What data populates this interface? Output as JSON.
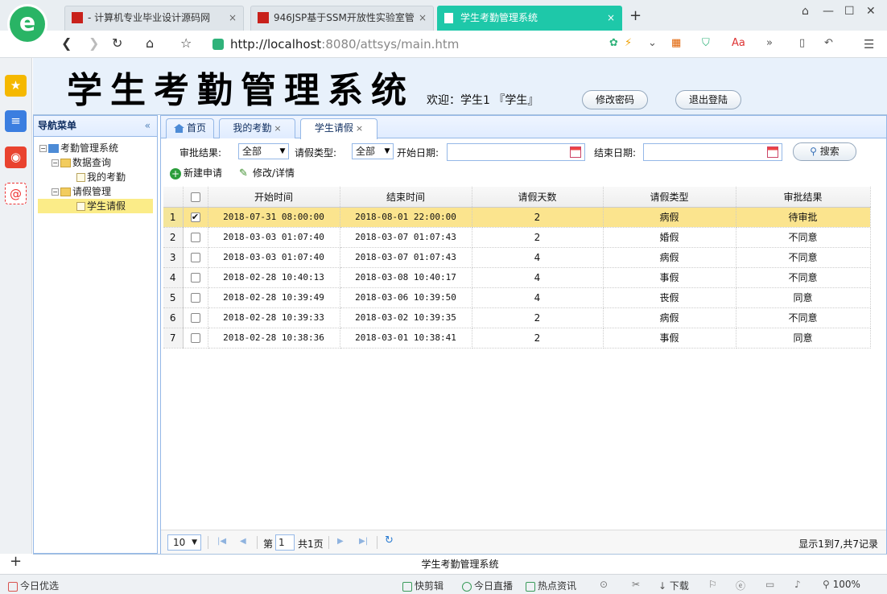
{
  "browser": {
    "tabs": [
      {
        "label": "- 计算机专业毕业设计源码网",
        "close": "×"
      },
      {
        "label": "946JSP基于SSM开放性实验室管",
        "close": "×"
      },
      {
        "label": "学生考勤管理系统",
        "close": "×"
      }
    ],
    "new_tab": "+",
    "url_host": "http://localhost",
    "url_rest": ":8080/attsys/main.htm"
  },
  "header": {
    "system_title": "学生考勤管理系统",
    "welcome": "欢迎：学生1 『学生』",
    "change_password_label": "修改密码",
    "logout_label": "退出登陆"
  },
  "nav": {
    "title": "导航菜单",
    "collapse": "«",
    "tree": {
      "root": "考勤管理系统",
      "group1": "数据查询",
      "group1_item1": "我的考勤",
      "group2": "请假管理",
      "group2_item1": "学生请假"
    }
  },
  "tabs": {
    "home": "首页",
    "attendance": "我的考勤",
    "leave": "学生请假",
    "close": "×"
  },
  "filters": {
    "approval_label": "审批结果:",
    "approval_value": "全部",
    "type_label": "请假类型:",
    "type_value": "全部",
    "start_label": "开始日期:",
    "end_label": "结束日期:",
    "search_label": "搜索"
  },
  "actions": {
    "new_label": "新建申请",
    "edit_label": "修改/详情"
  },
  "grid": {
    "columns": {
      "start": "开始时间",
      "end": "结束时间",
      "days": "请假天数",
      "type": "请假类型",
      "result": "审批结果"
    },
    "rows": [
      {
        "n": "1",
        "start": "2018-07-31 08:00:00",
        "end": "2018-08-01 22:00:00",
        "days": "2",
        "type": "病假",
        "result": "待审批"
      },
      {
        "n": "2",
        "start": "2018-03-03 01:07:40",
        "end": "2018-03-07 01:07:43",
        "days": "2",
        "type": "婚假",
        "result": "不同意"
      },
      {
        "n": "3",
        "start": "2018-03-03 01:07:40",
        "end": "2018-03-07 01:07:43",
        "days": "4",
        "type": "病假",
        "result": "不同意"
      },
      {
        "n": "4",
        "start": "2018-02-28 10:40:13",
        "end": "2018-03-08 10:40:17",
        "days": "4",
        "type": "事假",
        "result": "不同意"
      },
      {
        "n": "5",
        "start": "2018-02-28 10:39:49",
        "end": "2018-03-06 10:39:50",
        "days": "4",
        "type": "丧假",
        "result": "同意"
      },
      {
        "n": "6",
        "start": "2018-02-28 10:39:33",
        "end": "2018-03-02 10:39:35",
        "days": "2",
        "type": "病假",
        "result": "不同意"
      },
      {
        "n": "7",
        "start": "2018-02-28 10:38:36",
        "end": "2018-03-01 10:38:41",
        "days": "2",
        "type": "事假",
        "result": "同意"
      }
    ]
  },
  "pager": {
    "page_size": "10",
    "page_prefix": "第",
    "page_value": "1",
    "page_total": "共1页",
    "summary": "显示1到7,共7记录"
  },
  "footer": {
    "text": "学生考勤管理系统"
  },
  "statusbar": {
    "left": "今日优选",
    "items": [
      "快剪辑",
      "今日直播",
      "热点资讯",
      "下载"
    ],
    "zoom": "100%"
  }
}
